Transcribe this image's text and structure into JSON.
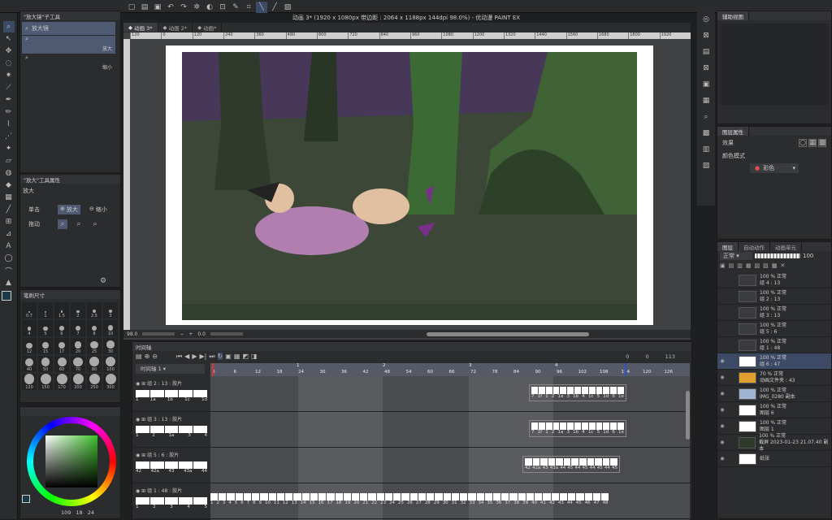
{
  "window": {
    "title": "动画 3* (1920 x 1080px 带边距 : 2064 x 1188px 144dpi 98.0%) - 优动漫 PAINT EX"
  },
  "doc_tabs": [
    "动画 3*",
    "动画 2*",
    "动画*"
  ],
  "ruler": [
    "120",
    "0",
    "120",
    "240",
    "360",
    "480",
    "600",
    "720",
    "840",
    "960",
    "1080",
    "1200",
    "1320",
    "1440",
    "1560",
    "1680",
    "1800",
    "1920"
  ],
  "sub_tool_panel": {
    "title": "\"放大镜\"子工具",
    "items": [
      {
        "label": "放大镜"
      },
      {
        "label": "放大"
      },
      {
        "label": "缩小"
      }
    ]
  },
  "tool_prop_panel": {
    "title": "\"放大\"工具属性",
    "heading": "放大",
    "click_label": "单击",
    "zoom_in": "放大",
    "zoom_out": "缩小",
    "drag_label": "拖动"
  },
  "brush_panel": {
    "title": "笔刷尺寸",
    "sizes": [
      "0.7",
      "1",
      "1.5",
      "2",
      "2.5",
      "3",
      "4",
      "5",
      "6",
      "7",
      "8",
      "10",
      "12",
      "15",
      "17",
      "20",
      "25",
      "30",
      "40",
      "50",
      "60",
      "70",
      "80",
      "100",
      "120",
      "150",
      "170",
      "200",
      "250",
      "300"
    ]
  },
  "color_values": {
    "h": "109",
    "s": "18",
    "v": "24"
  },
  "canvas_status": {
    "zoom": "98.0",
    "angle": "0.0"
  },
  "timeline": {
    "title": "时间轴",
    "name": "时间轴 1",
    "counters": [
      "0",
      "0",
      "113"
    ],
    "frames": [
      "0",
      "6",
      "12",
      "18",
      "24",
      "30",
      "36",
      "42",
      "48",
      "54",
      "60",
      "66",
      "72",
      "78",
      "84",
      "90",
      "96",
      "102",
      "108",
      "114",
      "120",
      "126"
    ],
    "seconds": [
      "1",
      "2",
      "3",
      "4"
    ],
    "tracks": [
      {
        "name": "组 2 : 13 : 胶片",
        "cells": [
          "1",
          "1a",
          "1b",
          "1c",
          "1d"
        ],
        "right_cells": [
          "7",
          "1f",
          "1",
          "2",
          "1a",
          "3",
          "1b",
          "4",
          "1c",
          "5",
          "1d",
          "6",
          "1e"
        ]
      },
      {
        "name": "组 3 : 13 : 胶片",
        "cells": [
          "1",
          "2",
          "1a",
          "3",
          "4"
        ],
        "right_cells": [
          "7",
          "1f",
          "1",
          "2",
          "1a",
          "3",
          "1b",
          "4",
          "1c",
          "5",
          "1d",
          "6",
          "1e"
        ]
      },
      {
        "name": "组 5 : 6 : 胶片",
        "cells": [
          "42",
          "42a",
          "43",
          "43a",
          "44"
        ],
        "right_cells": [
          "42",
          "42a",
          "43",
          "43a",
          "44",
          "45",
          "44",
          "45",
          "44",
          "45",
          "44",
          "45"
        ]
      },
      {
        "name": "组 1 : 48 : 胶片",
        "cells": [
          "1",
          "2",
          "3",
          "4",
          "5"
        ],
        "right_cells": [
          "1",
          "2",
          "3",
          "4",
          "5",
          "6",
          "7",
          "8",
          "9",
          "10",
          "11",
          "12",
          "13",
          "14",
          "15",
          "16",
          "17",
          "18",
          "19",
          "20",
          "21",
          "22",
          "23",
          "24",
          "25",
          "26",
          "27",
          "28",
          "29",
          "30",
          "31",
          "32",
          "33",
          "34",
          "35",
          "36",
          "37",
          "38",
          "39",
          "40",
          "41",
          "42",
          "43",
          "44",
          "45",
          "46",
          "47",
          "48"
        ]
      }
    ]
  },
  "nav_panel": {
    "title": "辅助视图"
  },
  "layer_prop": {
    "title": "图层属性",
    "effect_label": "效果",
    "mode_label": "颜色模式",
    "mode_value": "彩色"
  },
  "layers_panel": {
    "tabs": [
      "图层",
      "自动动作",
      "动画单元"
    ],
    "blend": "正常",
    "opacity": "100",
    "layers": [
      {
        "pct": "100 % 正常",
        "name": "组 4 : 13"
      },
      {
        "pct": "100 % 正常",
        "name": "组 2 : 13"
      },
      {
        "pct": "100 % 正常",
        "name": "组 3 : 13"
      },
      {
        "pct": "100 % 正常",
        "name": "组 5 : 6"
      },
      {
        "pct": "100 % 正常",
        "name": "组 1 : 48"
      },
      {
        "pct": "100 % 正常",
        "name": "组 6 : 47"
      },
      {
        "pct": "70 % 正常",
        "name": "动画文件夹 : 43"
      },
      {
        "pct": "100 % 正常",
        "name": "IMG_0280 副本"
      },
      {
        "pct": "100 % 正常",
        "name": "图层 6"
      },
      {
        "pct": "100 % 正常",
        "name": "图层 1"
      },
      {
        "pct": "100 % 正常",
        "name": "截屏 2023-01-23 21.07.40 副本"
      },
      {
        "pct": "",
        "name": "纸张"
      }
    ]
  }
}
